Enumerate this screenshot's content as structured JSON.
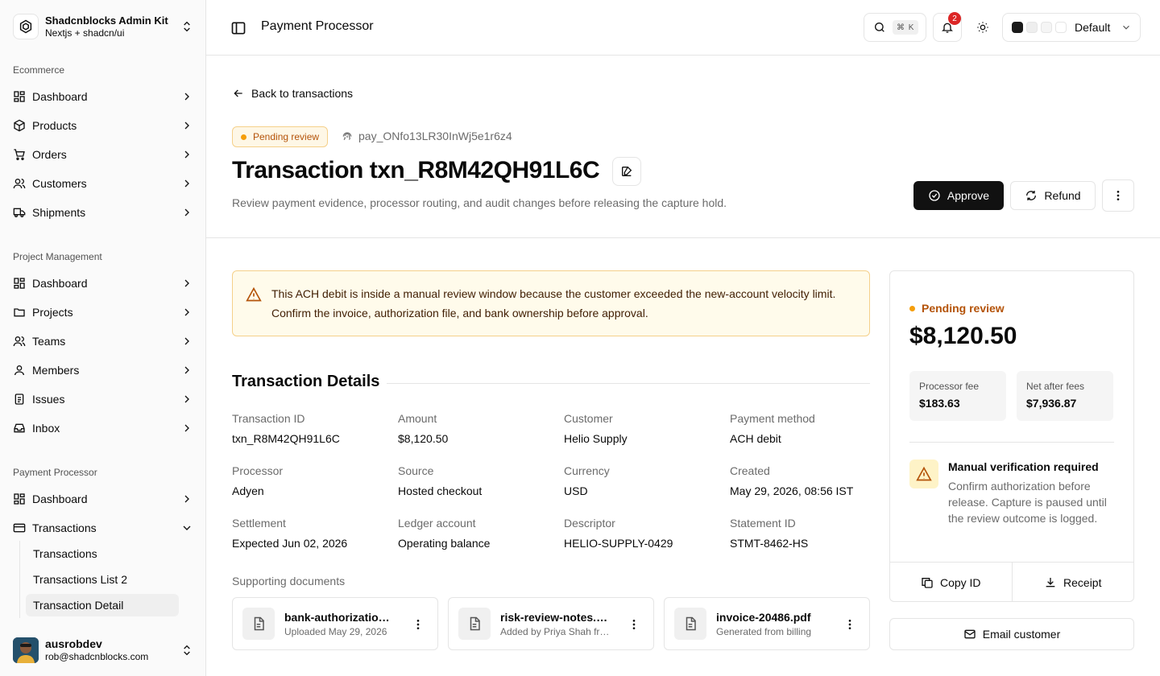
{
  "brand": {
    "name": "Shadcnblocks Admin Kit",
    "subtitle": "Nextjs + shadcn/ui"
  },
  "sidebar": {
    "sections": [
      {
        "label": "Ecommerce",
        "items": [
          "Dashboard",
          "Products",
          "Orders",
          "Customers",
          "Shipments"
        ]
      },
      {
        "label": "Project Management",
        "items": [
          "Dashboard",
          "Projects",
          "Teams",
          "Members",
          "Issues",
          "Inbox"
        ]
      },
      {
        "label": "Payment Processor",
        "items": [
          "Dashboard",
          "Transactions"
        ]
      }
    ],
    "sub_items": [
      "Transactions",
      "Transactions List 2",
      "Transaction Detail"
    ],
    "active_sub": "Transaction Detail"
  },
  "user": {
    "name": "ausrobdev",
    "email": "rob@shadcnblocks.com"
  },
  "topbar": {
    "title": "Payment Processor",
    "shortcut": "⌘ K",
    "notifications": "2",
    "theme": "Default"
  },
  "page": {
    "back_label": "Back to transactions",
    "status": "Pending review",
    "payment_id": "pay_ONfo13LR30InWj5e1r6z4",
    "title": "Transaction txn_R8M42QH91L6C",
    "subtitle": "Review payment evidence, processor routing, and audit changes before releasing the capture hold.",
    "approve_label": "Approve",
    "refund_label": "Refund"
  },
  "alert": {
    "text": "This ACH debit is inside a manual review window because the customer exceeded the new-account velocity limit. Confirm the invoice, authorization file, and bank ownership before approval."
  },
  "details": {
    "title": "Transaction Details",
    "fields": [
      {
        "label": "Transaction ID",
        "value": "txn_R8M42QH91L6C"
      },
      {
        "label": "Amount",
        "value": "$8,120.50"
      },
      {
        "label": "Customer",
        "value": "Helio Supply"
      },
      {
        "label": "Payment method",
        "value": "ACH debit"
      },
      {
        "label": "Processor",
        "value": "Adyen"
      },
      {
        "label": "Source",
        "value": "Hosted checkout"
      },
      {
        "label": "Currency",
        "value": "USD"
      },
      {
        "label": "Created",
        "value": "May 29, 2026, 08:56 IST"
      },
      {
        "label": "Settlement",
        "value": "Expected Jun 02, 2026"
      },
      {
        "label": "Ledger account",
        "value": "Operating balance"
      },
      {
        "label": "Descriptor",
        "value": "HELIO-SUPPLY-0429"
      },
      {
        "label": "Statement ID",
        "value": "STMT-8462-HS"
      }
    ],
    "docs_label": "Supporting documents",
    "docs": [
      {
        "name": "bank-authorization.pdf",
        "meta": "Uploaded May 29, 2026"
      },
      {
        "name": "risk-review-notes.txt",
        "meta": "Added by Priya Shah from risk"
      },
      {
        "name": "invoice-20486.pdf",
        "meta": "Generated from billing"
      }
    ]
  },
  "card": {
    "status": "Pending review",
    "amount": "$8,120.50",
    "fee_label": "Processor fee",
    "fee_value": "$183.63",
    "net_label": "Net after fees",
    "net_value": "$7,936.87",
    "warn_title": "Manual verification required",
    "warn_body": "Confirm authorization before release. Capture is paused until the review outcome is logged.",
    "copy_label": "Copy ID",
    "receipt_label": "Receipt",
    "email_label": "Email customer"
  },
  "colors": {
    "accent": "#111111",
    "warning": "#b45309",
    "warning_bg": "#fffbeb",
    "badge": "#dc2626"
  }
}
